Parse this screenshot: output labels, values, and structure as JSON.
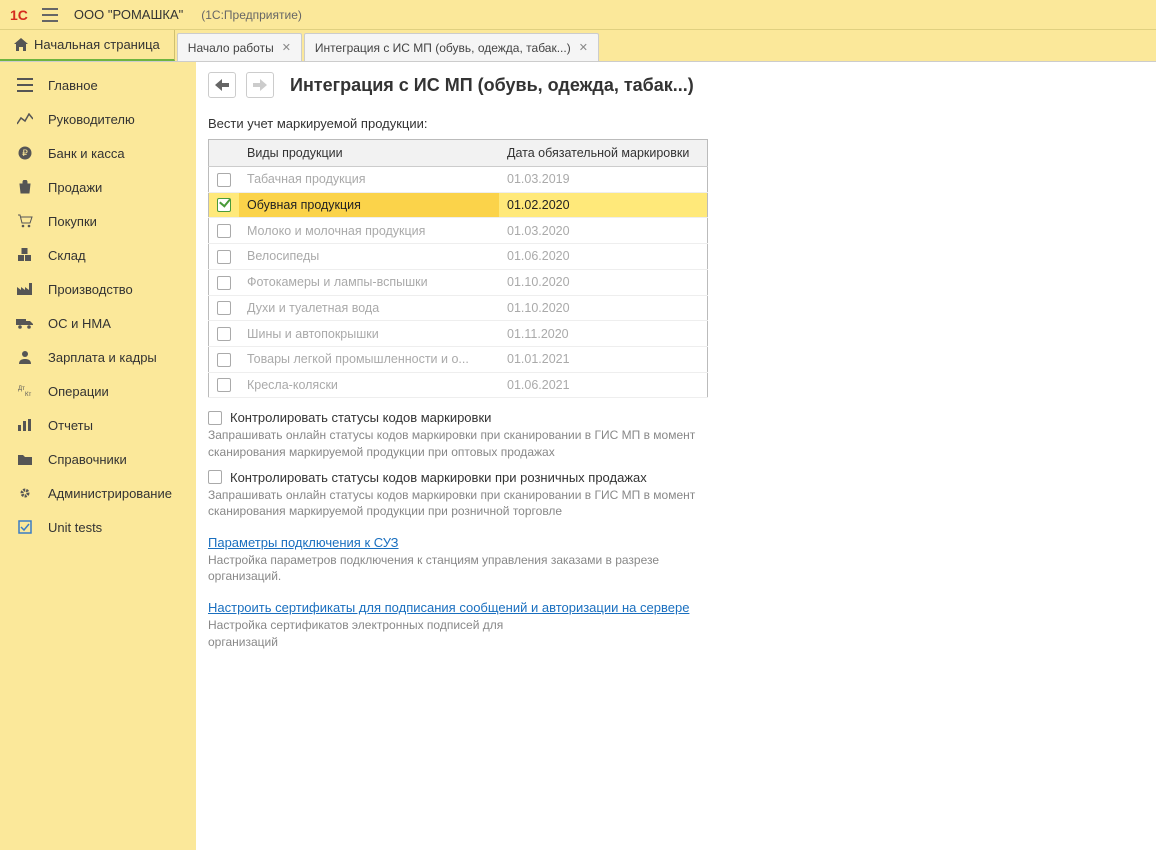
{
  "topbar": {
    "org": "ООО \"РОМАШКА\"",
    "product": "(1С:Предприятие)"
  },
  "tabs": {
    "home": "Начальная страница",
    "items": [
      {
        "label": "Начало работы"
      },
      {
        "label": "Интеграция с ИС МП (обувь, одежда, табак...)"
      }
    ]
  },
  "sidebar": {
    "items": [
      {
        "label": "Главное"
      },
      {
        "label": "Руководителю"
      },
      {
        "label": "Банк и касса"
      },
      {
        "label": "Продажи"
      },
      {
        "label": "Покупки"
      },
      {
        "label": "Склад"
      },
      {
        "label": "Производство"
      },
      {
        "label": "ОС и НМА"
      },
      {
        "label": "Зарплата и кадры"
      },
      {
        "label": "Операции"
      },
      {
        "label": "Отчеты"
      },
      {
        "label": "Справочники"
      },
      {
        "label": "Администрирование"
      },
      {
        "label": "Unit tests"
      }
    ]
  },
  "page": {
    "title": "Интеграция с ИС МП (обувь, одежда, табак...)",
    "intro": "Вести учет маркируемой продукции:",
    "table": {
      "head_type": "Виды продукции",
      "head_date": "Дата обязательной маркировки",
      "rows": [
        {
          "name": "Табачная продукция",
          "date": "01.03.2019",
          "checked": false
        },
        {
          "name": "Обувная продукция",
          "date": "01.02.2020",
          "checked": true
        },
        {
          "name": "Молоко и молочная продукция",
          "date": "01.03.2020",
          "checked": false
        },
        {
          "name": "Велосипеды",
          "date": "01.06.2020",
          "checked": false
        },
        {
          "name": "Фотокамеры и лампы-вспышки",
          "date": "01.10.2020",
          "checked": false
        },
        {
          "name": "Духи и туалетная вода",
          "date": "01.10.2020",
          "checked": false
        },
        {
          "name": "Шины и автопокрышки",
          "date": "01.11.2020",
          "checked": false
        },
        {
          "name": "Товары легкой промышленности и о...",
          "date": "01.01.2021",
          "checked": false
        },
        {
          "name": "Кресла-коляски",
          "date": "01.06.2021",
          "checked": false
        }
      ]
    },
    "opt1": {
      "label": "Контролировать статусы кодов маркировки",
      "desc": "Запрашивать онлайн статусы кодов маркировки при сканировании в ГИС МП в момент сканирования маркируемой продукции при оптовых продажах"
    },
    "opt2": {
      "label": "Контролировать статусы кодов маркировки при розничных продажах",
      "desc": "Запрашивать онлайн статусы кодов маркировки при сканировании в ГИС МП в момент сканирования маркируемой продукции при розничной торговле"
    },
    "link1": {
      "text": "Параметры подключения к СУЗ",
      "desc": "Настройка параметров подключения к станциям управления заказами в разрезе организаций."
    },
    "link2": {
      "text": "Настроить сертификаты для подписания сообщений и авторизации на сервере",
      "desc": "Настройка сертификатов электронных подписей для организаций"
    }
  }
}
